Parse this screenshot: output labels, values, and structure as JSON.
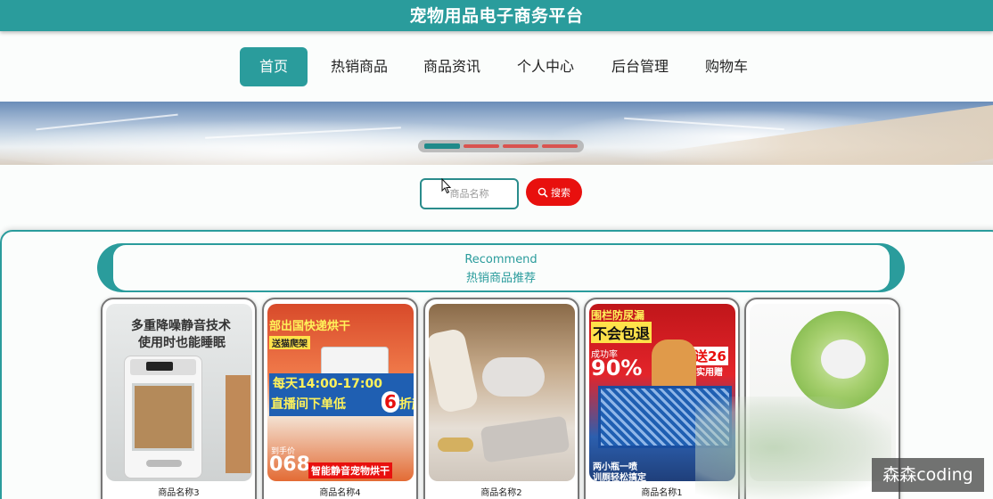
{
  "header": {
    "title": "宠物用品电子商务平台",
    "bg_color": "#2a9c9c"
  },
  "nav": {
    "items": [
      {
        "label": "首页",
        "active": true
      },
      {
        "label": "热销商品",
        "active": false
      },
      {
        "label": "商品资讯",
        "active": false
      },
      {
        "label": "个人中心",
        "active": false
      },
      {
        "label": "后台管理",
        "active": false
      },
      {
        "label": "购物车",
        "active": false
      }
    ]
  },
  "banner": {
    "slide_count": 4,
    "active_slide": 1
  },
  "search": {
    "placeholder": "商品名称",
    "value": "",
    "button_label": "搜索",
    "button_icon": "search-icon",
    "button_color": "#e8100e"
  },
  "recommend": {
    "title_en": "Recommend",
    "title_cn": "热销商品推荐"
  },
  "products": [
    {
      "name": "商品名称3",
      "image_text": [
        "多重降噪静音技术",
        "使用时也能睡眠"
      ]
    },
    {
      "name": "商品名称4",
      "image_text": [
        "部出国快递烘干",
        "送猫爬架",
        "每天14:00-17:00",
        "直播间下单低",
        "6",
        "折起",
        "到手价",
        "068",
        "智能静音宠物烘干"
      ]
    },
    {
      "name": "商品名称2",
      "image_text": []
    },
    {
      "name": "商品名称1",
      "image_text": [
        "围栏防尿漏",
        "不会包退",
        "成功率",
        "90%",
        "送26",
        "实用赠",
        "两小瓶一喷",
        "训厕轻松搞定"
      ]
    },
    {
      "name": "",
      "image_text": []
    }
  ],
  "watermark": "森森coding"
}
